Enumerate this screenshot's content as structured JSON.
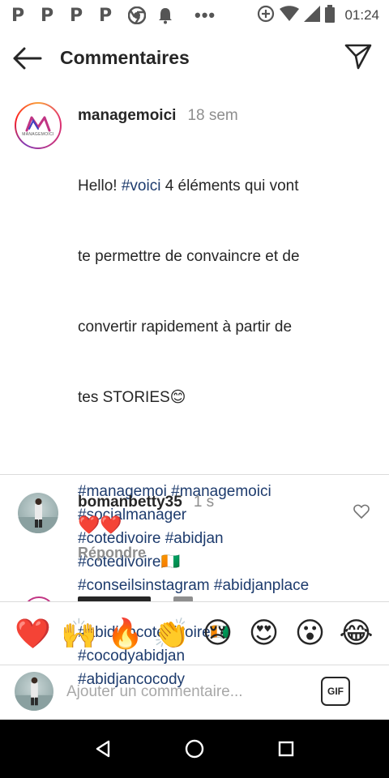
{
  "status_bar": {
    "p_icons": [
      "P",
      "P",
      "P",
      "P"
    ],
    "dots": "•••",
    "time": "01:24"
  },
  "header": {
    "title": "Commentaires"
  },
  "caption": {
    "username": "managemoici",
    "time_ago": "18 sem",
    "avatar_text": "MANAGEMOICI",
    "line1_prefix": "Hello! ",
    "line1_tag": "#voici",
    "line1_suffix": " 4 éléments qui vont",
    "line2": "te permettre de convaincre et de",
    "line3": "convertir rapidement à partir de",
    "line4": "tes STORIES😊",
    "tags_block1": [
      "#managemoi #managemoici",
      "#socialmanager",
      "#cotedivoire #abidjan",
      "#cotedivoire🇨🇮",
      "#conseilsinstagram #abidjanplace"
    ],
    "tags_block2": [
      "#abidjancotedivoire🇨🇮",
      "#cocodyabidjan",
      "#abidjancocody"
    ]
  },
  "comment": {
    "username": "bomanbetty35",
    "time_ago": "1 s",
    "text": "❤️❤️",
    "reply_label": "Répondre"
  },
  "emoji_bar": [
    "❤️",
    "🙌",
    "🔥",
    "👏",
    "😢",
    "😍",
    "😮",
    "😂"
  ],
  "input": {
    "placeholder": "Ajouter un commentaire...",
    "gif_label": "GIF"
  }
}
